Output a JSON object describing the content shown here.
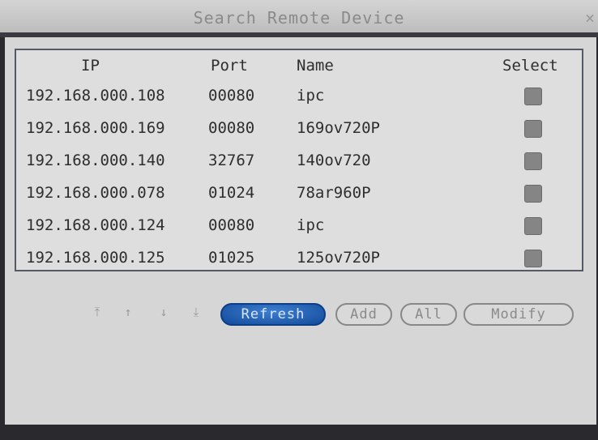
{
  "window": {
    "title": "Search Remote Device",
    "close_label": "×"
  },
  "table": {
    "headers": {
      "ip": "IP",
      "port": "Port",
      "name": "Name",
      "select": "Select"
    },
    "rows": [
      {
        "ip": "192.168.000.108",
        "port": "00080",
        "name": "ipc",
        "selected": false
      },
      {
        "ip": "192.168.000.169",
        "port": "00080",
        "name": "169ov720P",
        "selected": false
      },
      {
        "ip": "192.168.000.140",
        "port": "32767",
        "name": "140ov720",
        "selected": false
      },
      {
        "ip": "192.168.000.078",
        "port": "01024",
        "name": "78ar960P",
        "selected": false
      },
      {
        "ip": "192.168.000.124",
        "port": "00080",
        "name": "ipc",
        "selected": false
      },
      {
        "ip": "192.168.000.125",
        "port": "01025",
        "name": "125ov720P",
        "selected": false
      }
    ]
  },
  "nav": {
    "first": "⤒",
    "up": "↑",
    "down": "↓",
    "last": "⤓"
  },
  "buttons": {
    "refresh": "Refresh",
    "add": "Add",
    "all": "All",
    "modify": "Modify"
  },
  "colors": {
    "active_button": "#1f5fb5",
    "checkbox": "#858585",
    "panel": "#d6d6d6"
  }
}
